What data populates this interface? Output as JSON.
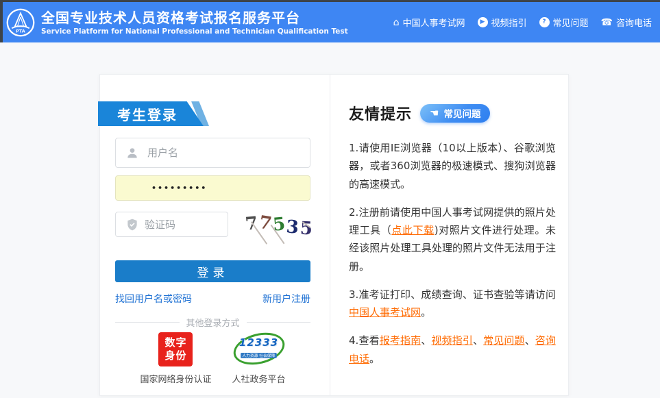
{
  "page": {
    "bg": "#f7f8fa",
    "topline_color": "#3d4349"
  },
  "header": {
    "bg": "#3e86f3",
    "logo_text": "PTA",
    "title": "全国专业技术人员资格考试报名服务平台",
    "subtitle": "Service Platform for National Professional and Technician Qualification Test",
    "nav": [
      {
        "glyph": "⌂",
        "label": "中国人事考试网"
      },
      {
        "glyph": "▶",
        "label": "视频指引"
      },
      {
        "glyph": "?",
        "label": "常见问题"
      },
      {
        "glyph": "☎",
        "label": "咨询电话"
      }
    ]
  },
  "login": {
    "banner_title": "考生登录",
    "banner_color": "#1a85d9",
    "username_placeholder": "用户名",
    "password_masked": "•••••••••",
    "password_bg": "#fafad0",
    "captcha_placeholder": "验证码",
    "captcha_text": "77535",
    "captcha_digits": [
      {
        "char": "7",
        "color": "#4d4d4d"
      },
      {
        "char": "7",
        "color": "#7d4b3e"
      },
      {
        "char": "5",
        "color": "#2e7d32"
      },
      {
        "char": "3",
        "color": "#1c2b6e"
      },
      {
        "char": "5",
        "color": "#35306b"
      }
    ],
    "login_button": "登录",
    "button_color": "#1a7dc9",
    "forgot_link": "找回用户名或密码",
    "register_link": "新用户注册",
    "link_color": "#1b6fd3",
    "other_methods_label": "其他登录方式",
    "methods": [
      {
        "icon_line1": "数字",
        "icon_line2": "身份",
        "icon_bg": "#e8221c",
        "label": "国家网络身份认证"
      },
      {
        "icon_text": "12333",
        "icon_subtext": "人力资源 社会保障",
        "ring_color": "#3aa02f",
        "text_color": "#1565c0",
        "label": "人社政务平台"
      }
    ]
  },
  "tips": {
    "title": "友情提示",
    "faq_button": {
      "glyph": "☚",
      "label": "常见问题"
    },
    "link_color": "#ff6a00",
    "items": [
      [
        {
          "t": "1.请使用IE浏览器（10以上版本）、谷歌浏览器，或者360浏览器的极速模式、搜狗浏览器的高速模式。"
        }
      ],
      [
        {
          "t": "2.注册前请使用中国人事考试网提供的照片处理工具（"
        },
        {
          "t": "点此下载",
          "link": true
        },
        {
          "t": ")对照片文件进行处理。未经该照片处理工具处理的照片文件无法用于注册。"
        }
      ],
      [
        {
          "t": "3.准考证打印、成绩查询、证书查验等请访问"
        },
        {
          "t": "中国人事考试网",
          "link": true
        },
        {
          "t": "。"
        }
      ],
      [
        {
          "t": "4.查看"
        },
        {
          "t": "报考指南",
          "link": true
        },
        {
          "t": "、"
        },
        {
          "t": "视频指引",
          "link": true
        },
        {
          "t": "、"
        },
        {
          "t": "常见问题",
          "link": true
        },
        {
          "t": "、"
        },
        {
          "t": "咨询电话",
          "link": true
        },
        {
          "t": "。"
        }
      ]
    ]
  }
}
